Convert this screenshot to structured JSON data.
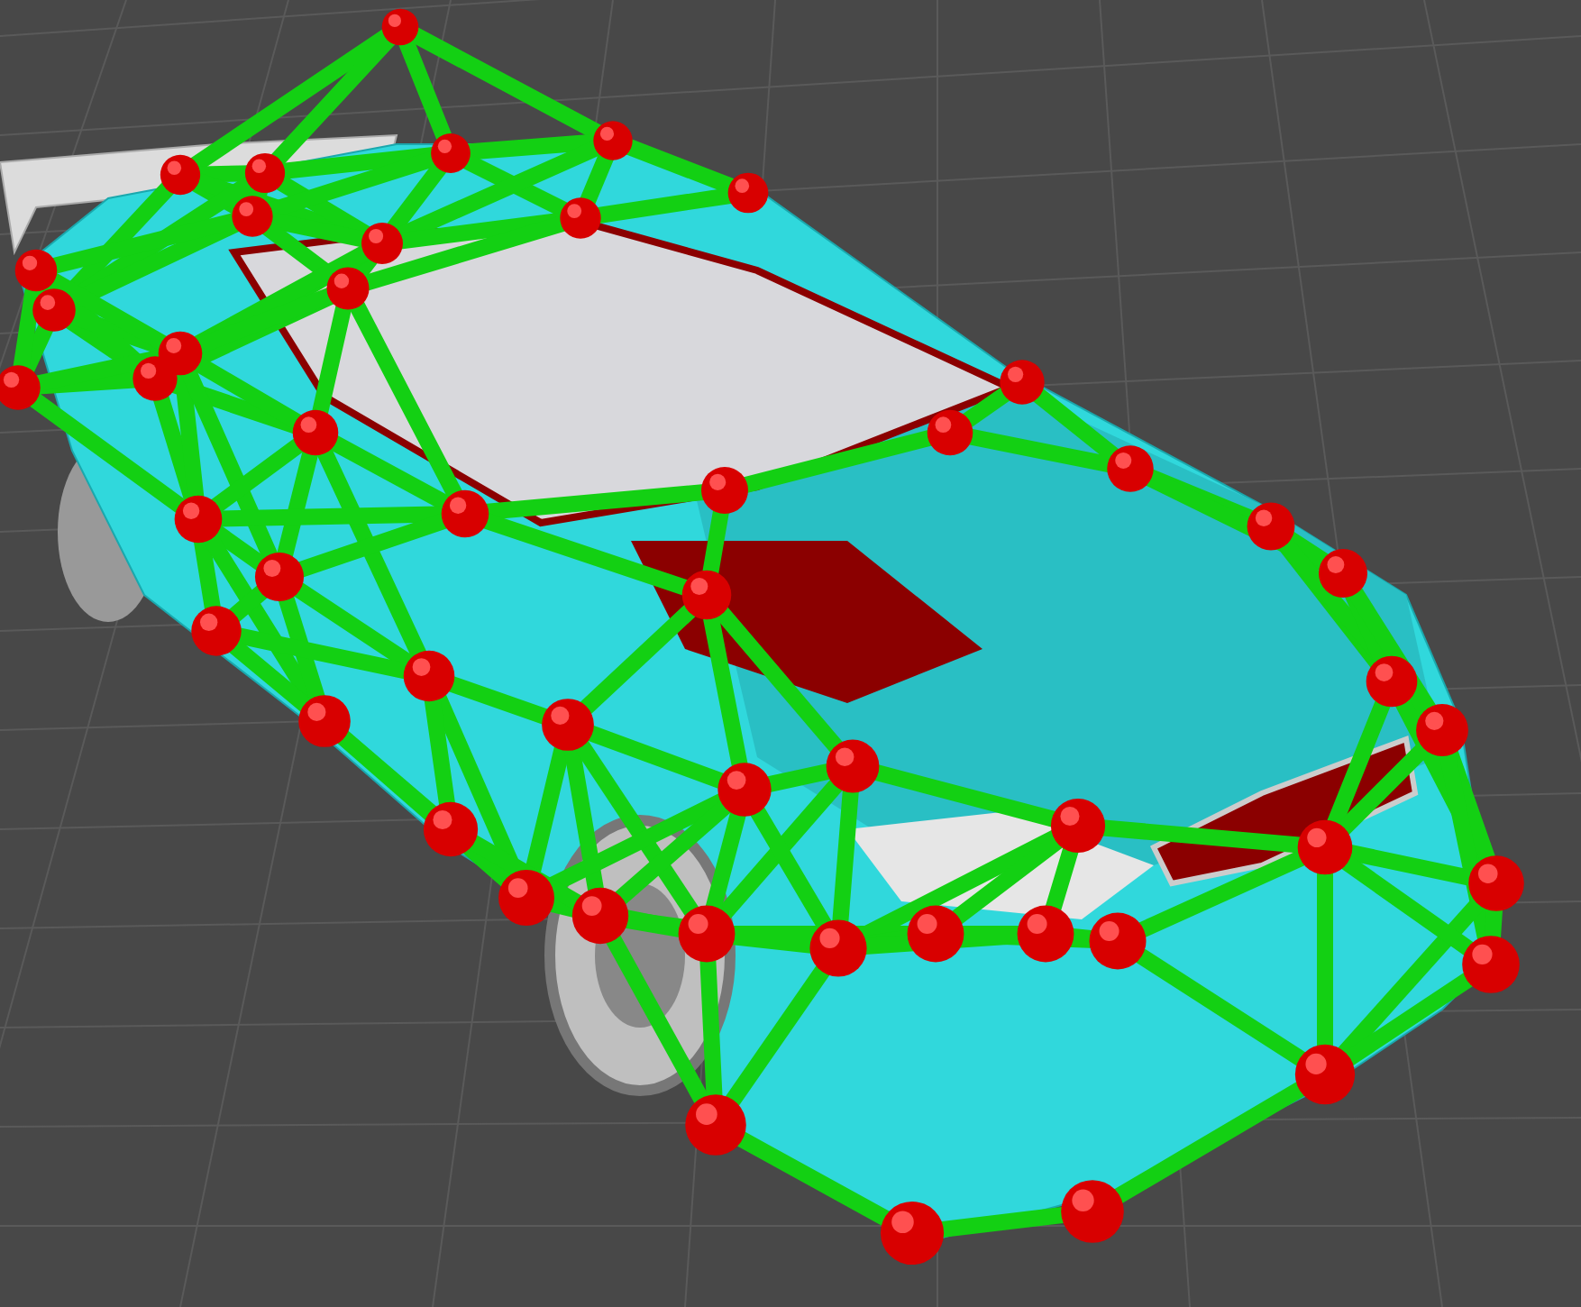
{
  "viewport": {
    "kind": "scene-3d"
  }
}
